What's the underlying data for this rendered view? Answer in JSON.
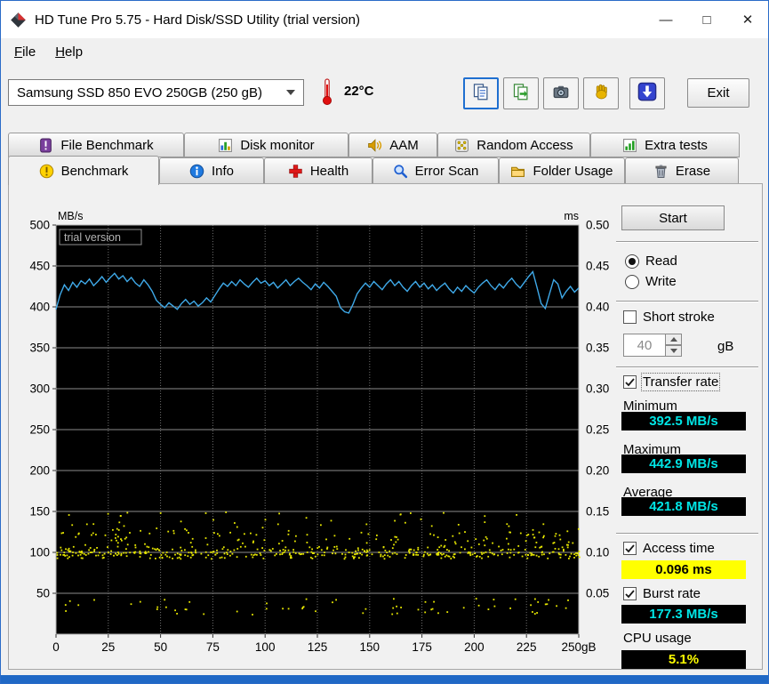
{
  "window": {
    "title": "HD Tune Pro 5.75 - Hard Disk/SSD Utility (trial version)",
    "controls": {
      "minimize": "—",
      "maximize": "□",
      "close": "✕"
    }
  },
  "menu": {
    "items": [
      {
        "label": "File"
      },
      {
        "label": "Help"
      }
    ]
  },
  "toolbar": {
    "drive_select": "Samsung SSD 850 EVO 250GB (250 gB)",
    "temperature": "22°C",
    "exit_label": "Exit"
  },
  "tabs": {
    "row1": [
      {
        "label": "File Benchmark"
      },
      {
        "label": "Disk monitor"
      },
      {
        "label": "AAM"
      },
      {
        "label": "Random Access"
      },
      {
        "label": "Extra tests"
      }
    ],
    "row2": [
      {
        "label": "Benchmark",
        "active": true
      },
      {
        "label": "Info"
      },
      {
        "label": "Health"
      },
      {
        "label": "Error Scan"
      },
      {
        "label": "Folder Usage"
      },
      {
        "label": "Erase"
      }
    ]
  },
  "controls": {
    "start": "Start",
    "read": "Read",
    "write": "Write",
    "short_stroke": "Short stroke",
    "capacity_value": "40",
    "capacity_unit": "gB",
    "transfer_rate": "Transfer rate",
    "minimum_label": "Minimum",
    "minimum_value": "392.5 MB/s",
    "maximum_label": "Maximum",
    "maximum_value": "442.9 MB/s",
    "average_label": "Average",
    "average_value": "421.8 MB/s",
    "access_time": "Access time",
    "access_value": "0.096 ms",
    "burst_rate": "Burst rate",
    "burst_value": "177.3 MB/s",
    "cpu_label": "CPU usage",
    "cpu_value": "5.1%"
  },
  "chart_data": {
    "type": "line",
    "title": "trial version",
    "left_axis": {
      "label": "MB/s",
      "range": [
        0,
        500
      ],
      "ticks": [
        500,
        450,
        400,
        350,
        300,
        250,
        200,
        150,
        100,
        50
      ]
    },
    "right_axis": {
      "label": "ms",
      "range": [
        0,
        0.5
      ],
      "ticks": [
        "0.50",
        "0.45",
        "0.40",
        "0.35",
        "0.30",
        "0.25",
        "0.20",
        "0.15",
        "0.10",
        "0.05"
      ]
    },
    "x_axis": {
      "range": [
        0,
        250
      ],
      "ticks": [
        "0",
        "25",
        "50",
        "75",
        "100",
        "125",
        "150",
        "175",
        "200",
        "225",
        "250gB"
      ],
      "grid_step": 25
    },
    "series": [
      {
        "name": "Transfer rate",
        "kind": "line",
        "color": "#3fa9e8",
        "x_step": 2,
        "values": [
          397,
          415,
          427,
          420,
          430,
          424,
          432,
          428,
          434,
          426,
          431,
          437,
          430,
          436,
          441,
          434,
          438,
          431,
          436,
          429,
          425,
          433,
          427,
          419,
          408,
          403,
          399,
          405,
          401,
          397,
          404,
          409,
          403,
          407,
          401,
          405,
          411,
          406,
          414,
          422,
          429,
          425,
          431,
          426,
          433,
          428,
          424,
          430,
          435,
          429,
          432,
          426,
          430,
          423,
          428,
          433,
          426,
          431,
          435,
          430,
          426,
          421,
          428,
          423,
          430,
          425,
          419,
          413,
          399,
          394,
          392.5,
          403,
          416,
          423,
          429,
          424,
          431,
          426,
          421,
          428,
          433,
          426,
          431,
          424,
          419,
          426,
          431,
          424,
          429,
          422,
          427,
          420,
          425,
          429,
          422,
          417,
          424,
          419,
          426,
          421,
          417,
          424,
          429,
          433,
          426,
          421,
          428,
          423,
          430,
          435,
          428,
          423,
          430,
          437,
          442.9,
          424,
          404,
          398,
          416,
          433,
          428,
          411,
          419,
          425,
          418,
          423
        ]
      },
      {
        "name": "Access time",
        "kind": "scatter",
        "color": "#e6e600",
        "seed": 1337,
        "bands": [
          {
            "count": 130,
            "x": [
              0,
              250
            ],
            "y": [
              97,
              101.5
            ]
          },
          {
            "count": 270,
            "x": [
              0,
              250
            ],
            "y": [
              93,
              108
            ]
          },
          {
            "count": 110,
            "x": [
              0,
              250
            ],
            "y": [
              108,
              128
            ]
          },
          {
            "count": 40,
            "x": [
              0,
              250
            ],
            "y": [
              128,
              150
            ]
          },
          {
            "count": 16,
            "x": [
              26,
              34
            ],
            "y": [
              104,
              152
            ]
          },
          {
            "count": 66,
            "x": [
              2,
              248
            ],
            "y": [
              24,
              45
            ]
          }
        ]
      }
    ]
  }
}
